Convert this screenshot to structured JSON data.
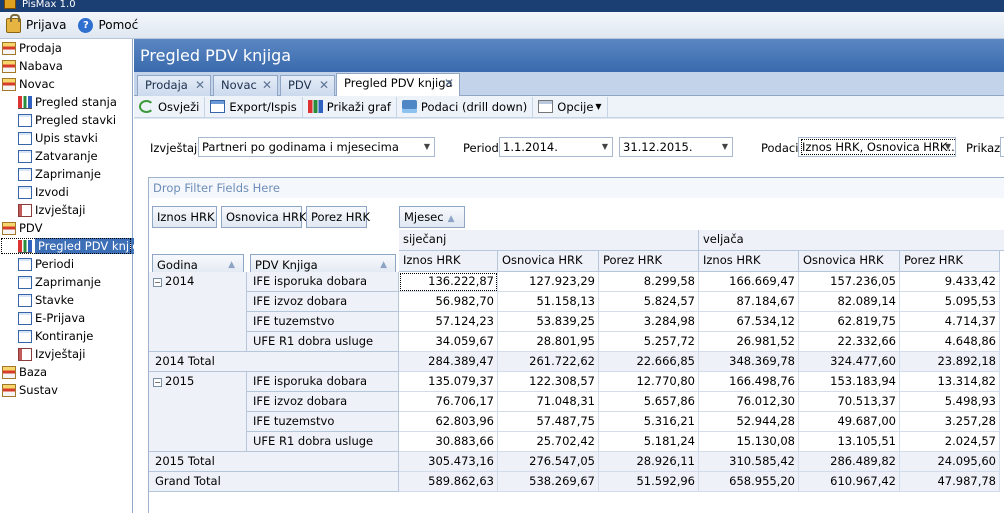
{
  "app": {
    "title": "PisMax 1.0"
  },
  "menu": {
    "login": "Prijava",
    "help": "Pomoć"
  },
  "sidebar": {
    "items": [
      {
        "label": "Prodaja",
        "level": 0,
        "icon": "category-icon"
      },
      {
        "label": "Nabava",
        "level": 0,
        "icon": "category-icon"
      },
      {
        "label": "Novac",
        "level": 0,
        "icon": "category-icon"
      },
      {
        "label": "Pregled stanja",
        "level": 1,
        "icon": "chart-icon"
      },
      {
        "label": "Pregled stavki",
        "level": 1,
        "icon": "document-icon"
      },
      {
        "label": "Upis stavki",
        "level": 1,
        "icon": "document-icon"
      },
      {
        "label": "Zatvaranje",
        "level": 1,
        "icon": "document-icon"
      },
      {
        "label": "Zaprimanje",
        "level": 1,
        "icon": "document-icon"
      },
      {
        "label": "Izvodi",
        "level": 1,
        "icon": "document-icon"
      },
      {
        "label": "Izvještaji",
        "level": 1,
        "icon": "report-icon"
      },
      {
        "label": "PDV",
        "level": 0,
        "icon": "category-icon"
      },
      {
        "label": "Pregled PDV knjiga",
        "level": 1,
        "icon": "chart-icon",
        "selected": true
      },
      {
        "label": "Periodi",
        "level": 1,
        "icon": "document-icon"
      },
      {
        "label": "Zaprimanje",
        "level": 1,
        "icon": "document-icon"
      },
      {
        "label": "Stavke",
        "level": 1,
        "icon": "document-icon"
      },
      {
        "label": "E-Prijava",
        "level": 1,
        "icon": "document-icon"
      },
      {
        "label": "Kontiranje",
        "level": 1,
        "icon": "document-icon"
      },
      {
        "label": "Izvještaji",
        "level": 1,
        "icon": "report-icon"
      },
      {
        "label": "Baza",
        "level": 0,
        "icon": "category-icon"
      },
      {
        "label": "Sustav",
        "level": 0,
        "icon": "category-icon"
      }
    ]
  },
  "main": {
    "header": "Pregled PDV knjiga",
    "tabs": [
      "Prodaja",
      "Novac",
      "PDV",
      "Pregled PDV knjiga"
    ],
    "toolbar": {
      "refresh": "Osvježi",
      "export": "Export/Ispis",
      "graph": "Prikaži graf",
      "drill": "Podaci (drill down)",
      "options": "Opcije"
    },
    "params": {
      "report_label": "Izvještaj",
      "report_value": "Partneri po godinama i mjesecima",
      "period_label": "Period",
      "date_from": "1.1.2014.",
      "date_to": "31.12.2015.",
      "data_label": "Podaci",
      "data_value": "Iznos HRK, Osnovica HRK...",
      "show_label": "Prikaz"
    }
  },
  "pivot": {
    "drop_hint": "Drop Filter Fields Here",
    "data_fields": [
      "Iznos HRK",
      "Osnovica HRK",
      "Porez HRK"
    ],
    "column_field": "Mjesec",
    "row_fields": [
      "Godina",
      "PDV Knjiga"
    ],
    "months": [
      "siječanj",
      "veljača"
    ],
    "measures": [
      "Iznos HRK",
      "Osnovica HRK",
      "Porez HRK",
      "Iznos HRK",
      "Osnovica HRK",
      "Porez HRK"
    ],
    "groups": [
      {
        "year": "2014",
        "rows": [
          {
            "book": "IFE isporuka dobara",
            "vals": [
              "136.222,87",
              "127.923,29",
              "8.299,58",
              "166.669,47",
              "157.236,05",
              "9.433,42"
            ]
          },
          {
            "book": "IFE izvoz dobara",
            "vals": [
              "56.982,70",
              "51.158,13",
              "5.824,57",
              "87.184,67",
              "82.089,14",
              "5.095,53"
            ]
          },
          {
            "book": "IFE tuzemstvo",
            "vals": [
              "57.124,23",
              "53.839,25",
              "3.284,98",
              "67.534,12",
              "62.819,75",
              "4.714,37"
            ]
          },
          {
            "book": "UFE R1 dobra usluge",
            "vals": [
              "34.059,67",
              "28.801,95",
              "5.257,72",
              "26.981,52",
              "22.332,66",
              "4.648,86"
            ]
          }
        ],
        "total_label": "2014 Total",
        "total": [
          "284.389,47",
          "261.722,62",
          "22.666,85",
          "348.369,78",
          "324.477,60",
          "23.892,18"
        ]
      },
      {
        "year": "2015",
        "rows": [
          {
            "book": "IFE isporuka dobara",
            "vals": [
              "135.079,37",
              "122.308,57",
              "12.770,80",
              "166.498,76",
              "153.183,94",
              "13.314,82"
            ]
          },
          {
            "book": "IFE izvoz dobara",
            "vals": [
              "76.706,17",
              "71.048,31",
              "5.657,86",
              "76.012,30",
              "70.513,37",
              "5.498,93"
            ]
          },
          {
            "book": "IFE tuzemstvo",
            "vals": [
              "62.803,96",
              "57.487,75",
              "5.316,21",
              "52.944,28",
              "49.687,00",
              "3.257,28"
            ]
          },
          {
            "book": "UFE R1 dobra usluge",
            "vals": [
              "30.883,66",
              "25.702,42",
              "5.181,24",
              "15.130,08",
              "13.105,51",
              "2.024,57"
            ]
          }
        ],
        "total_label": "2015 Total",
        "total": [
          "305.473,16",
          "276.547,05",
          "28.926,11",
          "310.585,42",
          "286.489,82",
          "24.095,60"
        ]
      }
    ],
    "grand_label": "Grand Total",
    "grand": [
      "589.862,63",
      "538.269,67",
      "51.592,96",
      "658.955,20",
      "610.967,42",
      "47.987,78"
    ]
  }
}
